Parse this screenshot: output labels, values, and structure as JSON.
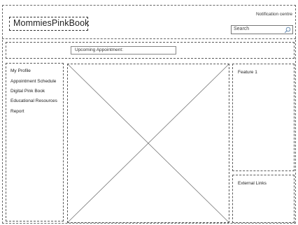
{
  "header": {
    "logo_text": "MommiesPinkBook",
    "notification_label": "Notification centre",
    "search": {
      "placeholder": "Search",
      "icon": "search-icon"
    }
  },
  "appointments_bar": {
    "label": "Upcoming Appointment:"
  },
  "sidebar": {
    "items": [
      {
        "label": "My Profile"
      },
      {
        "label": "Appointment Schedule"
      },
      {
        "label": "Digital Pink Book"
      },
      {
        "label": "Educational Resources"
      },
      {
        "label": "Report"
      }
    ]
  },
  "main": {
    "content": "image-placeholder"
  },
  "right_panel": {
    "feature_title": "Feature 1",
    "links_title": "External Links"
  }
}
